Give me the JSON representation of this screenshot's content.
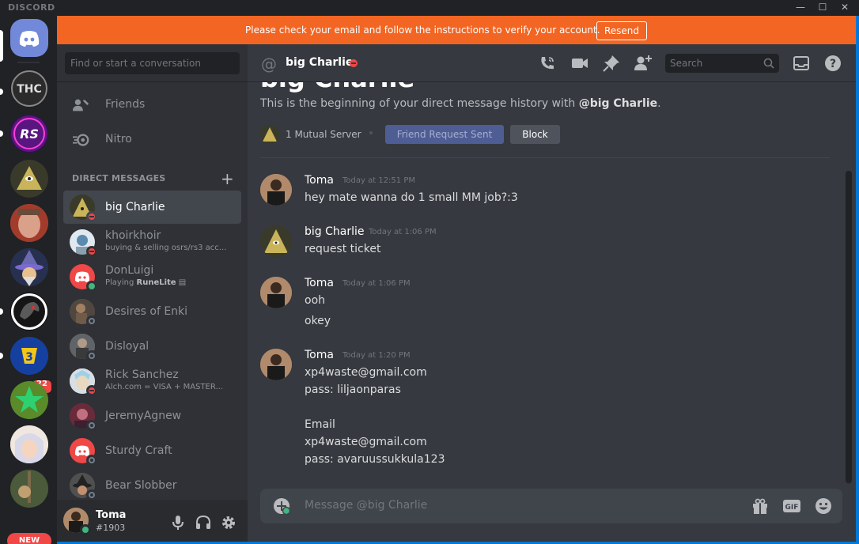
{
  "window": {
    "brand": "DISCORD",
    "min_icon": "minimize-icon",
    "max_icon": "maximize-icon",
    "close_icon": "close-icon"
  },
  "colors": {
    "blurple": "#7289da",
    "banner": "#f26522",
    "online": "#43b581",
    "dnd": "#f04747",
    "offline": "#747f8d",
    "sidebar": "#2f3136",
    "chat": "#36393f"
  },
  "guild_rail": {
    "home_icon": "discord-logo-icon",
    "servers": [
      {
        "name": "THC server",
        "initials": "THC"
      },
      {
        "name": "RS server",
        "initials": "RS"
      },
      {
        "name": "pyramid server",
        "initials": ""
      },
      {
        "name": "face server",
        "initials": ""
      },
      {
        "name": "wizard server",
        "initials": ""
      },
      {
        "name": "dragon server",
        "initials": ""
      },
      {
        "name": "yellow emblem server",
        "initials": "",
        "badge": "22"
      },
      {
        "name": "green star server",
        "initials": ""
      },
      {
        "name": "anime server",
        "initials": ""
      },
      {
        "name": "warrior server",
        "initials": ""
      }
    ],
    "new_label": "NEW"
  },
  "banner": {
    "text": "Please check your email and follow the instructions to verify your account.",
    "button": "Resend"
  },
  "sidebar": {
    "search_placeholder": "Find or start a conversation",
    "nav": [
      {
        "label": "Friends",
        "icon": "friends-icon"
      },
      {
        "label": "Nitro",
        "icon": "nitro-icon"
      }
    ],
    "dm_header": "DIRECT MESSAGES",
    "add_dm_icon": "plus-icon",
    "dms": [
      {
        "name": "big Charlie",
        "status": "dnd",
        "sub": "",
        "active": true
      },
      {
        "name": "khoirkhoir",
        "status": "dnd",
        "sub": "buying & selling osrs/rs3 acc..."
      },
      {
        "name": "DonLuigi",
        "status": "online",
        "sub_prefix": "Playing ",
        "sub_game": "RuneLite"
      },
      {
        "name": "Desires of Enki",
        "status": "offline",
        "sub": ""
      },
      {
        "name": "Disloyal",
        "status": "offline",
        "sub": ""
      },
      {
        "name": "Rick Sanchez",
        "status": "dnd",
        "sub": "Alch.com = VISA + MASTER..."
      },
      {
        "name": "JeremyAgnew",
        "status": "offline",
        "sub": ""
      },
      {
        "name": "Sturdy Craft",
        "status": "offline",
        "sub": ""
      },
      {
        "name": "Bear Slobber",
        "status": "offline",
        "sub": ""
      }
    ]
  },
  "user": {
    "name": "Toma",
    "tag": "#1903",
    "mic_icon": "microphone-icon",
    "headset_icon": "headphones-icon",
    "settings_icon": "gear-icon"
  },
  "chat": {
    "header_name": "big Charlie",
    "search_placeholder": "Search",
    "intro_heading": "big Charlie",
    "intro_prefix": "This is the beginning of your direct message history with ",
    "intro_mention": "@big Charlie",
    "intro_suffix": ".",
    "mutual": "1 Mutual Server",
    "friend_btn": "Friend Request Sent",
    "block_btn": "Block",
    "messages": [
      {
        "author": "Toma",
        "time": "Today at 12:51 PM",
        "lines": [
          "hey mate wanna do 1 small MM job?:3"
        ]
      },
      {
        "author": "big Charlie",
        "time": "Today at 1:06 PM",
        "lines": [
          "request ticket"
        ]
      },
      {
        "author": "Toma",
        "time": "Today at 1:06 PM",
        "lines": [
          "ooh",
          "okey"
        ]
      },
      {
        "author": "Toma",
        "time": "Today at 1:20 PM",
        "lines": [
          "xp4waste@gmail.com",
          "pass: liljaonparas",
          "",
          "Email",
          "xp4waste@gmail.com",
          "pass: avaruussukkula123"
        ]
      }
    ],
    "composer_placeholder": "Message @big Charlie"
  }
}
